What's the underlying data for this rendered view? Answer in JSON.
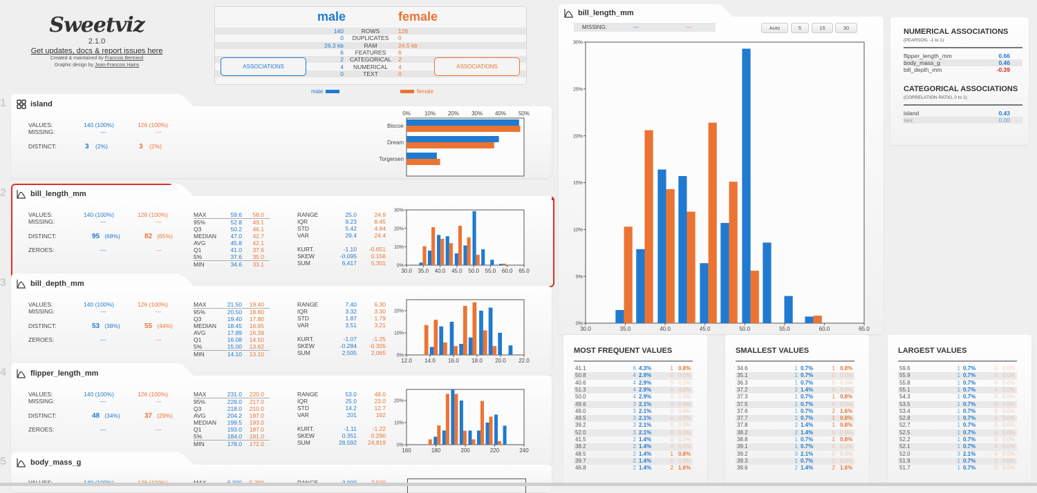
{
  "header": {
    "logo": "Sweetviz",
    "version": "2.1.0",
    "link_text": "Get updates, docs & report issues here",
    "credit_created_prefix": "Created & maintained by",
    "credit_created_name": "Francois Bertrand",
    "credit_design_prefix": "Graphic design by",
    "credit_design_name": "Jean-Francois Hains"
  },
  "colors": {
    "male": "#1f7ad0",
    "female": "#ec7433",
    "selected_border": "#d6322b",
    "negative": "#e02020"
  },
  "summary": {
    "male_title": "male",
    "female_title": "female",
    "rows": [
      {
        "label": "ROWS",
        "male": "140",
        "female": "126"
      },
      {
        "label": "DUPLICATES",
        "male": "0",
        "female": "0"
      },
      {
        "label": "RAM",
        "male": "26.3 kb",
        "female": "24.5 kb"
      },
      {
        "label": "FEATURES",
        "male": "6",
        "female": "6"
      },
      {
        "label": "CATEGORICAL",
        "male": "2",
        "female": "2"
      },
      {
        "label": "NUMERICAL",
        "male": "4",
        "female": "4"
      },
      {
        "label": "TEXT",
        "male": "0",
        "female": "0"
      }
    ],
    "assoc_male_label": "ASSOCIATIONS",
    "assoc_female_label": "ASSOCIATIONS",
    "legend_male": "male",
    "legend_female": "female"
  },
  "labels": {
    "values": "VALUES:",
    "missing": "MISSING:",
    "distinct": "DISTINCT:",
    "zeroes": "ZEROES:",
    "dash": "---"
  },
  "features": [
    {
      "index": "1",
      "name": "island",
      "type": "categorical",
      "values_male": "140 (100%)",
      "values_female": "126 (100%)",
      "missing_male": "---",
      "missing_female": "---",
      "distinct_male": "3",
      "distinct_male_pct": "(2%)",
      "distinct_female": "3",
      "distinct_female_pct": "(2%)"
    },
    {
      "index": "2",
      "name": "bill_length_mm",
      "type": "numerical",
      "selected": true,
      "values_male": "140 (100%)",
      "values_female": "126 (100%)",
      "missing_male": "---",
      "missing_female": "---",
      "distinct_male": "95",
      "distinct_male_pct": "(68%)",
      "distinct_female": "82",
      "distinct_female_pct": "(65%)",
      "zeroes_male": "---",
      "zeroes_female": "---",
      "quantiles": [
        {
          "k": "MAX",
          "m": "59.6",
          "f": "58.0"
        },
        {
          "k": "95%",
          "m": "52.8",
          "f": "49.1"
        },
        {
          "k": "Q3",
          "m": "50.2",
          "f": "46.1"
        },
        {
          "k": "MEDIAN",
          "m": "47.0",
          "f": "42.7"
        },
        {
          "k": "AVG",
          "m": "45.8",
          "f": "42.1"
        },
        {
          "k": "Q1",
          "m": "41.0",
          "f": "37.6"
        },
        {
          "k": "5%",
          "m": "37.6",
          "f": "35.0"
        },
        {
          "k": "MIN",
          "m": "34.6",
          "f": "33.1"
        }
      ],
      "moments": [
        {
          "k": "RANGE",
          "m": "25.0",
          "f": "24.9"
        },
        {
          "k": "IQR",
          "m": "9.23",
          "f": "8.45"
        },
        {
          "k": "STD",
          "m": "5.42",
          "f": "4.94"
        },
        {
          "k": "VAR",
          "m": "29.4",
          "f": "24.4"
        },
        {
          "k": "",
          "m": "",
          "f": ""
        },
        {
          "k": "KURT.",
          "m": "-1.10",
          "f": "-0.651"
        },
        {
          "k": "SKEW",
          "m": "-0.095",
          "f": "0.156"
        },
        {
          "k": "SUM",
          "m": "6,417",
          "f": "5,301"
        }
      ]
    },
    {
      "index": "3",
      "name": "bill_depth_mm",
      "type": "numerical",
      "values_male": "140 (100%)",
      "values_female": "126 (100%)",
      "missing_male": "---",
      "missing_female": "---",
      "distinct_male": "53",
      "distinct_male_pct": "(38%)",
      "distinct_female": "55",
      "distinct_female_pct": "(44%)",
      "zeroes_male": "---",
      "zeroes_female": "---",
      "quantiles": [
        {
          "k": "MAX",
          "m": "21.50",
          "f": "19.40"
        },
        {
          "k": "95%",
          "m": "20.50",
          "f": "18.80"
        },
        {
          "k": "Q3",
          "m": "19.40",
          "f": "17.80"
        },
        {
          "k": "MEDIAN",
          "m": "18.45",
          "f": "16.95"
        },
        {
          "k": "AVG",
          "m": "17.89",
          "f": "16.39"
        },
        {
          "k": "Q1",
          "m": "16.08",
          "f": "14.50"
        },
        {
          "k": "5%",
          "m": "15.00",
          "f": "13.62"
        },
        {
          "k": "MIN",
          "m": "14.10",
          "f": "13.10"
        }
      ],
      "moments": [
        {
          "k": "RANGE",
          "m": "7.40",
          "f": "6.30"
        },
        {
          "k": "IQR",
          "m": "3.32",
          "f": "3.30"
        },
        {
          "k": "STD",
          "m": "1.87",
          "f": "1.79"
        },
        {
          "k": "VAR",
          "m": "3.51",
          "f": "3.21"
        },
        {
          "k": "",
          "m": "",
          "f": ""
        },
        {
          "k": "KURT.",
          "m": "-1.07",
          "f": "-1.25"
        },
        {
          "k": "SKEW",
          "m": "-0.284",
          "f": "-0.305"
        },
        {
          "k": "SUM",
          "m": "2,505",
          "f": "2,065"
        }
      ]
    },
    {
      "index": "4",
      "name": "flipper_length_mm",
      "type": "numerical",
      "values_male": "140 (100%)",
      "values_female": "126 (100%)",
      "missing_male": "---",
      "missing_female": "---",
      "distinct_male": "48",
      "distinct_male_pct": "(34%)",
      "distinct_female": "37",
      "distinct_female_pct": "(29%)",
      "zeroes_male": "---",
      "zeroes_female": "---",
      "quantiles": [
        {
          "k": "MAX",
          "m": "231.0",
          "f": "220.0"
        },
        {
          "k": "95%",
          "m": "229.0",
          "f": "217.0"
        },
        {
          "k": "Q3",
          "m": "218.0",
          "f": "210.0"
        },
        {
          "k": "AVG",
          "m": "204.2",
          "f": "197.0"
        },
        {
          "k": "MEDIAN",
          "m": "199.5",
          "f": "193.0"
        },
        {
          "k": "Q1",
          "m": "193.0",
          "f": "187.0"
        },
        {
          "k": "5%",
          "m": "184.0",
          "f": "181.0"
        },
        {
          "k": "MIN",
          "m": "178.0",
          "f": "172.0"
        }
      ],
      "moments": [
        {
          "k": "RANGE",
          "m": "53.0",
          "f": "48.0"
        },
        {
          "k": "IQR",
          "m": "25.0",
          "f": "23.0"
        },
        {
          "k": "STD",
          "m": "14.2",
          "f": "12.7"
        },
        {
          "k": "VAR",
          "m": "201",
          "f": "162"
        },
        {
          "k": "",
          "m": "",
          "f": ""
        },
        {
          "k": "KURT.",
          "m": "-1.11",
          "f": "-1.22"
        },
        {
          "k": "SKEW",
          "m": "0.351",
          "f": "0.290"
        },
        {
          "k": "SUM",
          "m": "28,592",
          "f": "24,819"
        }
      ]
    },
    {
      "index": "5",
      "name": "body_mass_g",
      "type": "numerical",
      "values_male": "140 (100%)",
      "values_female": "126 (100%)",
      "max_male": "6,300",
      "max_female": "5,200",
      "range_male": "3,000",
      "range_female": "2,500"
    }
  ],
  "detail": {
    "title": "bill_length_mm",
    "missing_label": "MISSING:",
    "missing_male": "---",
    "missing_female": "---",
    "bin_buttons": [
      "Auto",
      "5",
      "15",
      "30"
    ]
  },
  "associations": {
    "numerical_title": "NUMERICAL ASSOCIATIONS",
    "numerical_sub": "(PEARSON, -1 to 1)",
    "numerical": [
      {
        "name": "flipper_length_mm",
        "value": "0.66",
        "negative": false
      },
      {
        "name": "body_mass_g",
        "value": "0.46",
        "negative": false
      },
      {
        "name": "bill_depth_mm",
        "value": "-0.39",
        "negative": true
      }
    ],
    "categorical_title": "CATEGORICAL ASSOCIATIONS",
    "categorical_sub": "(CORRELATION RATIO, 0 to 1)",
    "categorical": [
      {
        "name": "island",
        "value": "0.43",
        "faded": false
      },
      {
        "name": "sex",
        "value": "0.00",
        "faded": true
      }
    ]
  },
  "value_tables": [
    {
      "title": "MOST FREQUENT VALUES",
      "rows": [
        [
          "41.1",
          "6",
          "4.3%",
          "1",
          "0.8%"
        ],
        [
          "50.8",
          "4",
          "2.9%",
          "0",
          "0.0%"
        ],
        [
          "40.6",
          "4",
          "2.9%",
          "0",
          "0.0%"
        ],
        [
          "51.3",
          "4",
          "2.9%",
          "0",
          "0.0%"
        ],
        [
          "50.0",
          "4",
          "2.9%",
          "0",
          "0.0%"
        ],
        [
          "49.6",
          "3",
          "2.1%",
          "0",
          "0.0%"
        ],
        [
          "49.0",
          "3",
          "2.1%",
          "0",
          "0.0%"
        ],
        [
          "49.5",
          "3",
          "2.1%",
          "0",
          "0.0%"
        ],
        [
          "39.2",
          "3",
          "2.1%",
          "0",
          "0.0%"
        ],
        [
          "52.0",
          "3",
          "2.1%",
          "0",
          "0.0%"
        ],
        [
          "41.5",
          "2",
          "1.4%",
          "0",
          "0.0%"
        ],
        [
          "38.2",
          "2",
          "1.4%",
          "0",
          "0.0%"
        ],
        [
          "48.5",
          "2",
          "1.4%",
          "1",
          "0.8%"
        ],
        [
          "39.7",
          "2",
          "1.4%",
          "0",
          "0.0%"
        ],
        [
          "46.8",
          "2",
          "1.4%",
          "2",
          "1.6%"
        ]
      ]
    },
    {
      "title": "SMALLEST VALUES",
      "rows": [
        [
          "34.6",
          "1",
          "0.7%",
          "1",
          "0.8%"
        ],
        [
          "35.1",
          "1",
          "0.7%",
          "0",
          "0.0%"
        ],
        [
          "36.3",
          "1",
          "0.7%",
          "0",
          "0.0%"
        ],
        [
          "37.2",
          "2",
          "1.4%",
          "0",
          "0.0%"
        ],
        [
          "37.3",
          "1",
          "0.7%",
          "1",
          "0.8%"
        ],
        [
          "37.5",
          "1",
          "0.7%",
          "0",
          "0.0%"
        ],
        [
          "37.6",
          "1",
          "0.7%",
          "2",
          "1.6%"
        ],
        [
          "37.7",
          "1",
          "0.7%",
          "1",
          "0.8%"
        ],
        [
          "37.8",
          "2",
          "1.4%",
          "1",
          "0.8%"
        ],
        [
          "38.2",
          "2",
          "1.4%",
          "0",
          "0.0%"
        ],
        [
          "38.8",
          "1",
          "0.7%",
          "1",
          "0.8%"
        ],
        [
          "39.1",
          "1",
          "0.7%",
          "0",
          "0.0%"
        ],
        [
          "39.2",
          "3",
          "2.1%",
          "0",
          "0.0%"
        ],
        [
          "39.3",
          "1",
          "0.7%",
          "0",
          "0.0%"
        ],
        [
          "39.6",
          "2",
          "1.4%",
          "2",
          "1.6%"
        ]
      ]
    },
    {
      "title": "LARGEST VALUES",
      "rows": [
        [
          "59.6",
          "1",
          "0.7%",
          "0",
          "0.0%"
        ],
        [
          "55.9",
          "1",
          "0.7%",
          "0",
          "0.0%"
        ],
        [
          "55.8",
          "1",
          "0.7%",
          "0",
          "0.0%"
        ],
        [
          "55.1",
          "1",
          "0.7%",
          "0",
          "0.0%"
        ],
        [
          "54.3",
          "1",
          "0.7%",
          "0",
          "0.0%"
        ],
        [
          "53.5",
          "1",
          "0.7%",
          "0",
          "0.0%"
        ],
        [
          "53.4",
          "1",
          "0.7%",
          "0",
          "0.0%"
        ],
        [
          "52.8",
          "1",
          "0.7%",
          "0",
          "0.0%"
        ],
        [
          "52.7",
          "1",
          "0.7%",
          "0",
          "0.0%"
        ],
        [
          "52.5",
          "1",
          "0.7%",
          "0",
          "0.0%"
        ],
        [
          "52.2",
          "1",
          "0.7%",
          "0",
          "0.0%"
        ],
        [
          "52.1",
          "1",
          "0.7%",
          "0",
          "0.0%"
        ],
        [
          "52.0",
          "3",
          "2.1%",
          "0",
          "0.0%"
        ],
        [
          "51.9",
          "1",
          "0.7%",
          "0",
          "0.0%"
        ],
        [
          "51.7",
          "1",
          "0.7%",
          "0",
          "0.0%"
        ]
      ]
    }
  ],
  "chart_data": [
    {
      "id": "island-bars",
      "type": "bar",
      "orientation": "horizontal",
      "categories": [
        "Biscoe",
        "Dream",
        "Torgersen"
      ],
      "series": [
        {
          "name": "male",
          "values": [
            47.9,
            39.3,
            12.9
          ]
        },
        {
          "name": "female",
          "values": [
            48.4,
            37.3,
            14.3
          ]
        }
      ],
      "xlim": [
        0,
        50
      ],
      "xticks": [
        "0%",
        "10%",
        "20%",
        "30%",
        "40%",
        "50%"
      ]
    },
    {
      "id": "bill-length-hist",
      "type": "bar",
      "x_bins": [
        33.5,
        36.1,
        38.8,
        41.4,
        44.1,
        46.7,
        49.4,
        52.0,
        54.7,
        57.3
      ],
      "bin_width": 2.65,
      "series": [
        {
          "name": "male",
          "values": [
            1.4,
            7.9,
            16.4,
            15.7,
            6.4,
            10.7,
            29.3,
            8.6,
            2.9,
            0.7
          ]
        },
        {
          "name": "female",
          "values": [
            10.3,
            20.6,
            14.3,
            11.9,
            21.4,
            15.1,
            5.6,
            0,
            0,
            0.8
          ]
        }
      ],
      "xlim": [
        30,
        65
      ],
      "ylim": [
        0,
        30
      ],
      "xticks": [
        "30.0",
        "35.0",
        "40.0",
        "45.0",
        "50.0",
        "55.0",
        "60.0",
        "65.0"
      ],
      "yticks": [
        "0%",
        "10%",
        "20%",
        "30%"
      ],
      "yticks_large": [
        "0%",
        "5%",
        "10%",
        "15%",
        "20%",
        "25%",
        "30%"
      ]
    },
    {
      "id": "bill-depth-hist",
      "type": "bar",
      "x_bins": [
        13.1,
        13.9,
        14.7,
        15.6,
        16.4,
        17.2,
        18.1,
        18.9,
        19.7,
        20.6
      ],
      "bin_width": 0.84,
      "series": [
        {
          "name": "male",
          "values": [
            0,
            3.6,
            12.9,
            15.0,
            5.0,
            7.9,
            20.0,
            21.4,
            10.0,
            4.3
          ]
        },
        {
          "name": "female",
          "values": [
            13.5,
            15.9,
            5.6,
            4.0,
            22.2,
            23.8,
            11.1,
            4.0,
            0,
            0
          ]
        }
      ],
      "xlim": [
        12,
        22
      ],
      "ylim": [
        0,
        25
      ],
      "xticks": [
        "12.0",
        "14.0",
        "16.0",
        "18.0",
        "20.0",
        "22.0"
      ],
      "yticks": [
        "0%",
        "10%",
        "20%"
      ]
    },
    {
      "id": "flipper-length-hist",
      "type": "bar",
      "x_bins": [
        172,
        177.9,
        183.8,
        189.7,
        195.6,
        201.5,
        207.4,
        213.3,
        219.2,
        225.1
      ],
      "bin_width": 5.9,
      "series": [
        {
          "name": "male",
          "values": [
            0,
            3.6,
            6.4,
            25.0,
            20.0,
            6.4,
            6.4,
            10.0,
            13.6,
            8.6
          ]
        },
        {
          "name": "female",
          "values": [
            2.4,
            8.7,
            23.0,
            23.0,
            6.3,
            2.4,
            19.8,
            12.7,
            1.6,
            0
          ]
        }
      ],
      "xlim": [
        160,
        240
      ],
      "ylim": [
        0,
        25
      ],
      "xticks": [
        "160",
        "180",
        "200",
        "220",
        "240"
      ],
      "yticks": [
        "0%",
        "10%",
        "20%"
      ]
    }
  ]
}
